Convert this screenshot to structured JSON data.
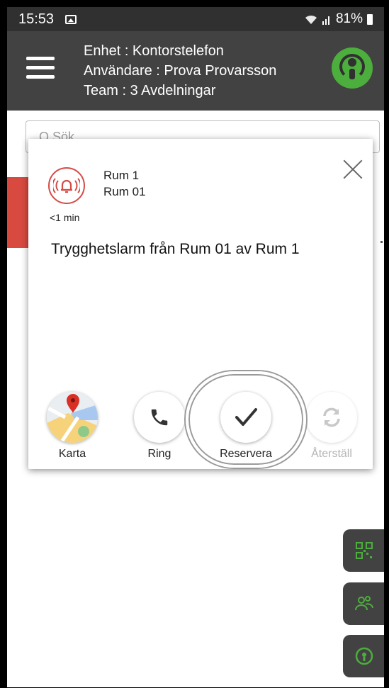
{
  "status_bar": {
    "time": "15:53",
    "battery": "81%"
  },
  "header": {
    "device": "Enhet : Kontorstelefon",
    "user": "Användare : Prova Provarsson",
    "team": "Team : 3 Avdelningar",
    "logo_color": "#4cae3c"
  },
  "background": {
    "search_placeholder": "Q  Sök"
  },
  "alarm": {
    "room_line1": "Rum 1",
    "room_line2": "Rum 01",
    "elapsed": "<1 min",
    "message": "Trygghetslarm från Rum 01 av Rum 1",
    "icon": "alarm-bell-icon",
    "alarm_color": "#d54b46"
  },
  "actions": {
    "map": "Karta",
    "call": "Ring",
    "reserve": "Reservera",
    "reset": "Återställ"
  },
  "side_buttons": [
    "qr-code-icon",
    "people-icon",
    "info-icon"
  ],
  "colors": {
    "header_bg": "#424242",
    "accent_green": "#4cae3c"
  }
}
